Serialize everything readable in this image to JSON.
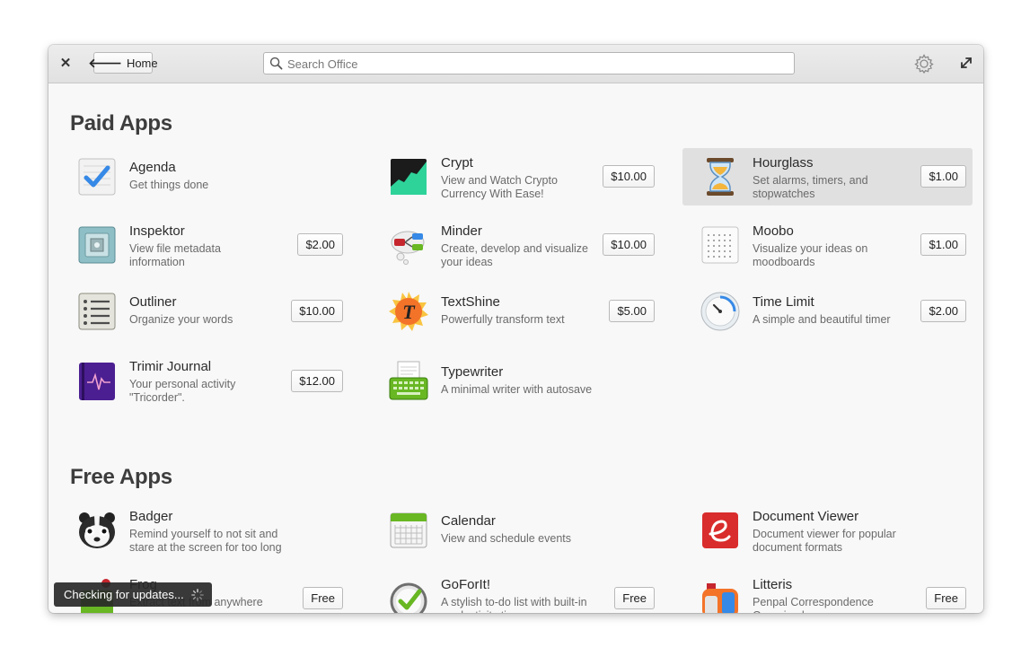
{
  "header": {
    "close_icon": "close-icon",
    "home_label": "Home",
    "search_placeholder": "Search Office",
    "settings_icon": "gear-icon",
    "maximize_icon": "maximize-icon"
  },
  "sections": {
    "paid_title": "Paid Apps",
    "free_title": "Free Apps"
  },
  "paid_apps": [
    {
      "name": "Agenda",
      "desc": "Get things done",
      "price": ""
    },
    {
      "name": "Crypt",
      "desc": "View and Watch Crypto Currency With Ease!",
      "price": "$10.00"
    },
    {
      "name": "Hourglass",
      "desc": "Set alarms, timers, and stopwatches",
      "price": "$1.00",
      "selected": true
    },
    {
      "name": "Inspektor",
      "desc": "View file metadata information",
      "price": "$2.00"
    },
    {
      "name": "Minder",
      "desc": "Create, develop and visualize your ideas",
      "price": "$10.00"
    },
    {
      "name": "Moobo",
      "desc": "Visualize your ideas on moodboards",
      "price": "$1.00"
    },
    {
      "name": "Outliner",
      "desc": "Organize your words",
      "price": "$10.00"
    },
    {
      "name": "TextShine",
      "desc": "Powerfully transform text",
      "price": "$5.00"
    },
    {
      "name": "Time Limit",
      "desc": "A simple and beautiful timer",
      "price": "$2.00"
    },
    {
      "name": "Trimir Journal",
      "desc": "Your personal activity \"Tricorder\".",
      "price": "$12.00"
    },
    {
      "name": "Typewriter",
      "desc": "A minimal writer with autosave",
      "price": ""
    }
  ],
  "free_apps": [
    {
      "name": "Badger",
      "desc": "Remind yourself to not sit and stare at the screen for too long",
      "price": ""
    },
    {
      "name": "Calendar",
      "desc": "View and schedule events",
      "price": ""
    },
    {
      "name": "Document Viewer",
      "desc": "Document viewer for popular document formats",
      "price": ""
    },
    {
      "name": "Frog",
      "desc": "Extract text from anywhere",
      "price": "Free"
    },
    {
      "name": "GoForIt!",
      "desc": "A stylish to-do list with built-in productivity timer",
      "price": "Free"
    },
    {
      "name": "Litteris",
      "desc": "Penpal Correspondence Organized",
      "price": "Free"
    }
  ],
  "toast": {
    "text": "Checking for updates..."
  },
  "colors": {
    "accent": "#3689e6",
    "selected_row": "#e0e0e0"
  }
}
